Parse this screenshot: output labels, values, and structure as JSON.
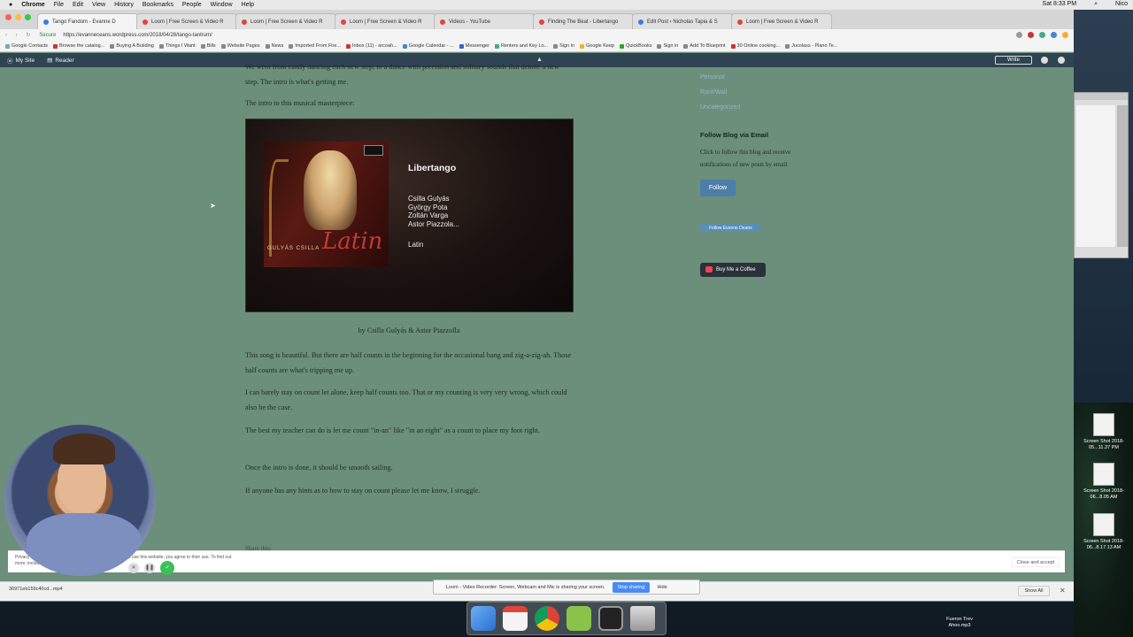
{
  "menubar": {
    "app": "Chrome",
    "items": [
      "File",
      "Edit",
      "View",
      "History",
      "Bookmarks",
      "People",
      "Window",
      "Help"
    ],
    "clock": "Sat 8:33 PM",
    "user": "Nico"
  },
  "tabs": [
    {
      "label": "Tango Fandom - Evanne D",
      "active": true,
      "color": "#3c7dd9"
    },
    {
      "label": "Loom | Free Screen & Video R",
      "active": false,
      "color": "#e0443b"
    },
    {
      "label": "Loom | Free Screen & Video R",
      "active": false,
      "color": "#e0443b"
    },
    {
      "label": "Loom | Free Screen & Video R",
      "active": false,
      "color": "#e0443b"
    },
    {
      "label": "Videos - YouTube",
      "active": false,
      "color": "#e0443b"
    },
    {
      "label": "Finding The Beat - Libertango",
      "active": false,
      "color": "#e0443b"
    },
    {
      "label": "Edit Post ‹ Nicholas Tapia & S",
      "active": false,
      "color": "#3c7dd9"
    },
    {
      "label": "Loom | Free Screen & Video R",
      "active": false,
      "color": "#e0443b"
    }
  ],
  "urlbar": {
    "secure": "Secure",
    "url": "https://evanneceans.wordpress.com/2018/04/28/tango-tantrum/"
  },
  "bookmarks": [
    "Google Contacts",
    "Browse the catalog...",
    "Buying A Building",
    "Things I Want",
    "Bills",
    "Website Pages",
    "News",
    "Imported From Fire...",
    "Inbox (11) - arcoah...",
    "Google Calendar - ...",
    "Messenger",
    "Renters and Key Lo...",
    "Sign in",
    "Google Keep",
    "QuickBooks",
    "Sign in",
    "Add To Blueprint",
    "30 Online cooking...",
    "Jucolass - Plano Te..."
  ],
  "wpbar": {
    "my_site": "My Site",
    "reader": "Reader",
    "write": "Write"
  },
  "article": {
    "p_top": "We went from candy dancing each new step, to a dance with precision and solitary sounds that denote a new step. The intro is what's getting me.",
    "p_intro": "The intro to this musical masterpiece:",
    "p1": "This song is beautiful. But there are half counts in the beginning for the occasional bang and zig-a-zig-ah. Those half counts are what's tripping me up.",
    "p2": "I can barely stay on count let alone, keep half counts too. That or my counting is very very wrong, which could also be the case.",
    "p3": "The best my teacher can do is let me count \"in-an\" like \"in an eight\" as a count to place my foot right.",
    "p4": "Once the intro is done, it should be smooth sailing.",
    "p5": "If anyone has any hints as to how to stay on count please let me know, I struggle.",
    "share": "Share this:"
  },
  "player": {
    "title": "Libertango",
    "artists": [
      "Csilla Gulyás",
      "György Pota",
      "Zoltán Varga",
      "Astor Piazzola..."
    ],
    "album": "Latin",
    "cover_label": "GULYÁS CSILLA",
    "cover_script": "Latin"
  },
  "caption": "by Csilla Gulyás & Astor Piazzolla",
  "sidebar": {
    "links": [
      "Personal",
      "Rant/Wall",
      "Uncategorized"
    ],
    "heading": "Follow Blog via Email",
    "desc": "Click to follow this blog and receive notifications of new posts by email.",
    "follow": "Follow",
    "badge": "Follow Evanne Deans",
    "coffee": "Buy Me a Coffee"
  },
  "cookie": {
    "text": "Privacy & Cookies: This site uses cookies. By continuing to use this website, you agree to their use. To find out more, including how to control cookies, see here:",
    "button": "Close and accept"
  },
  "downloads": {
    "file": "36971eb159c40cd...mp4",
    "show_all": "Show All"
  },
  "loom_share": {
    "text": "Loom - Video Recorder: Screen, Webcam and Mic is sharing your screen.",
    "stop": "Stop sharing",
    "hide": "Hide"
  },
  "desktop_files": [
    {
      "name": "Screen Shot 2018-05...11.37 PM"
    },
    {
      "name": "Screen Shot 2018-06...8.05 AM"
    },
    {
      "name": "Screen Shot 2018-06...8.17.13 AM"
    }
  ],
  "dock_label": "Fueron Trev Ahoo.mp3"
}
